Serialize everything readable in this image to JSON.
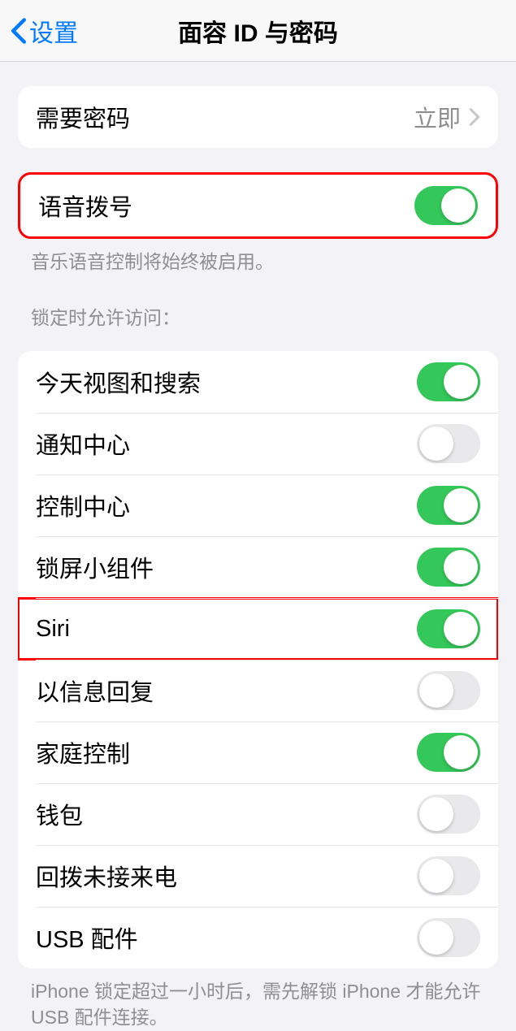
{
  "nav": {
    "back_label": "设置",
    "title": "面容 ID 与密码"
  },
  "require_passcode": {
    "label": "需要密码",
    "value": "立即"
  },
  "voice_dial": {
    "label": "语音拨号",
    "footer": "音乐语音控制将始终被启用。",
    "on": true
  },
  "lock_access": {
    "header": "锁定时允许访问：",
    "items": [
      {
        "label": "今天视图和搜索",
        "on": true,
        "highlighted": false
      },
      {
        "label": "通知中心",
        "on": false,
        "highlighted": false
      },
      {
        "label": "控制中心",
        "on": true,
        "highlighted": false
      },
      {
        "label": "锁屏小组件",
        "on": true,
        "highlighted": false
      },
      {
        "label": "Siri",
        "on": true,
        "highlighted": true
      },
      {
        "label": "以信息回复",
        "on": false,
        "highlighted": false
      },
      {
        "label": "家庭控制",
        "on": true,
        "highlighted": false
      },
      {
        "label": "钱包",
        "on": false,
        "highlighted": false
      },
      {
        "label": "回拨未接来电",
        "on": false,
        "highlighted": false
      },
      {
        "label": "USB 配件",
        "on": false,
        "highlighted": false
      }
    ],
    "footer": "iPhone 锁定超过一小时后，需先解锁 iPhone 才能允许USB 配件连接。"
  }
}
